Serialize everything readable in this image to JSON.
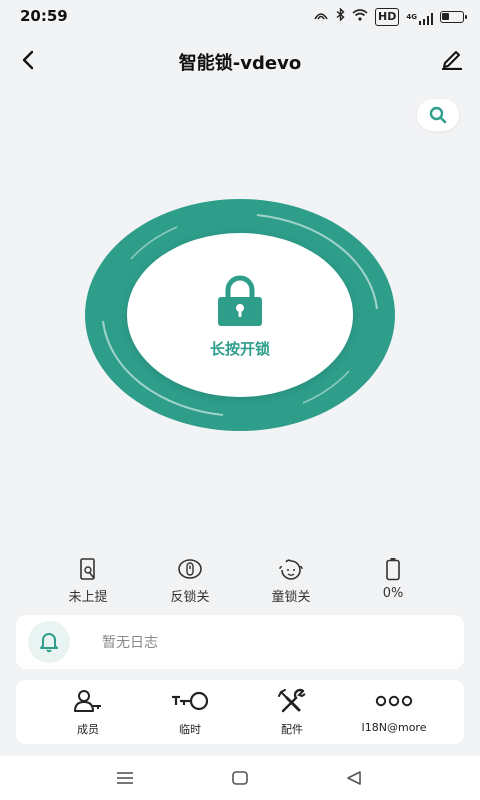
{
  "status_bar": {
    "time": "20:59",
    "signal_label": "4G",
    "hd_label": "HD",
    "battery_level": 0.35,
    "icons": [
      "nfc-icon",
      "bluetooth-icon",
      "wifi-icon",
      "hd-icon",
      "cellular-signal-icon",
      "battery-icon"
    ]
  },
  "nav": {
    "title": "智能锁-vdevo",
    "back_icon": "back-chevron-icon",
    "edit_icon": "edit-pencil-icon"
  },
  "search": {
    "icon": "search-icon"
  },
  "lock": {
    "label": "长按开锁",
    "icon": "padlock-icon",
    "ring_color": "#2e9e8b",
    "accent_color": "#2e9e8b"
  },
  "status_items": [
    {
      "icon": "door-icon",
      "label": "未上提"
    },
    {
      "icon": "lock-knob-icon",
      "label": "反锁关"
    },
    {
      "icon": "child-face-icon",
      "label": "童锁关"
    },
    {
      "icon": "battery-icon",
      "label": "0%"
    }
  ],
  "log": {
    "icon": "bell-icon",
    "text": "暂无日志"
  },
  "functions": [
    {
      "icon": "members-icon",
      "label": "成员"
    },
    {
      "icon": "temp-key-icon",
      "label": "临时"
    },
    {
      "icon": "tools-icon",
      "label": "配件"
    },
    {
      "icon": "more-dots-icon",
      "label": "I18N@more"
    }
  ],
  "system_nav": {
    "menu_icon": "menu-icon",
    "home_icon": "home-square-icon",
    "back_icon": "back-triangle-icon"
  }
}
